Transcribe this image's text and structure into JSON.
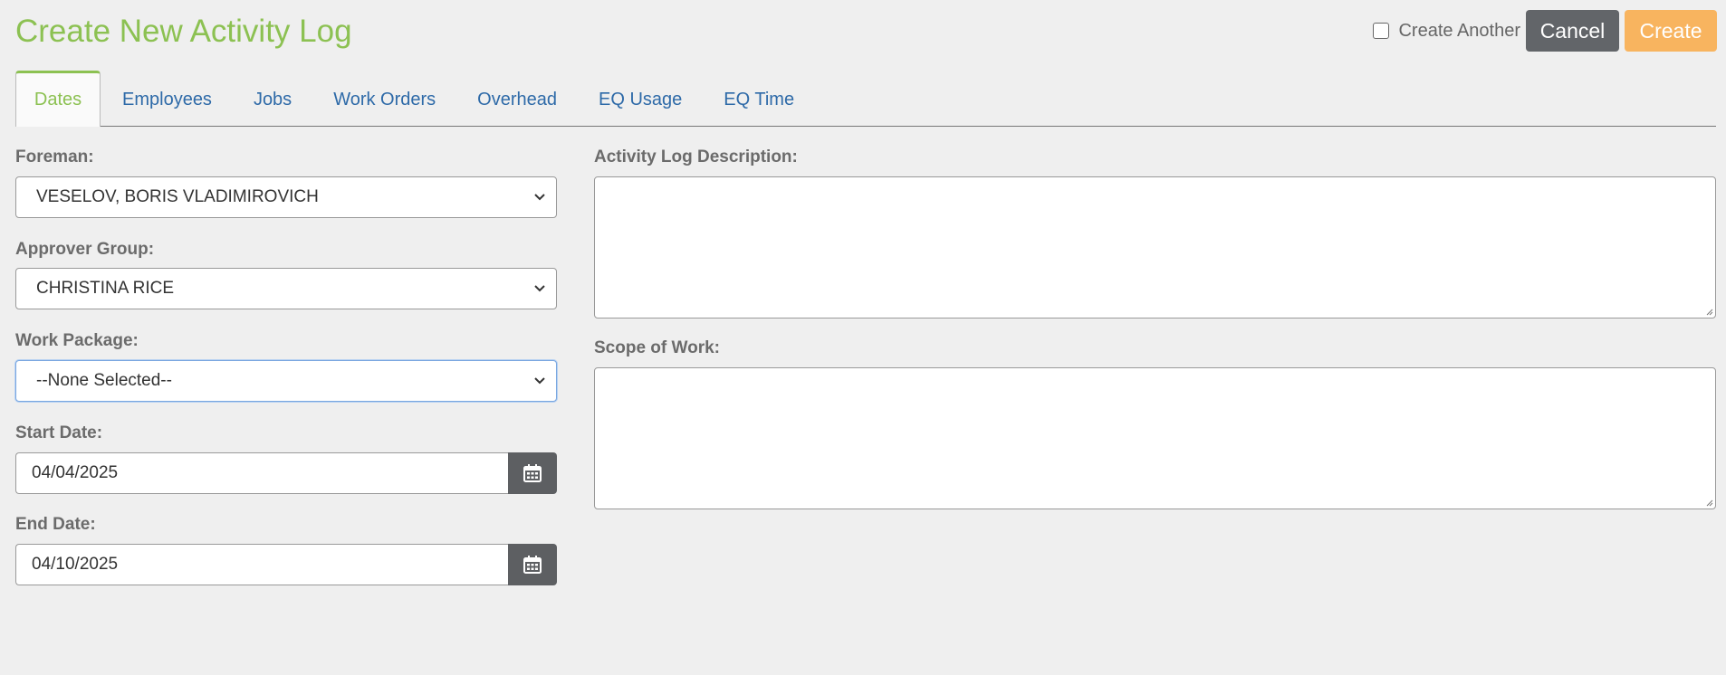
{
  "header": {
    "title": "Create New Activity Log",
    "create_another_label": "Create Another",
    "create_another_checked": false,
    "cancel_label": "Cancel",
    "create_label": "Create"
  },
  "tabs": [
    {
      "label": "Dates",
      "active": true
    },
    {
      "label": "Employees",
      "active": false
    },
    {
      "label": "Jobs",
      "active": false
    },
    {
      "label": "Work Orders",
      "active": false
    },
    {
      "label": "Overhead",
      "active": false
    },
    {
      "label": "EQ Usage",
      "active": false
    },
    {
      "label": "EQ Time",
      "active": false
    }
  ],
  "form": {
    "foreman": {
      "label": "Foreman:",
      "value": "VESELOV, BORIS VLADIMIROVICH"
    },
    "approver_group": {
      "label": "Approver Group:",
      "value": "CHRISTINA RICE"
    },
    "work_package": {
      "label": "Work Package:",
      "value": "--None Selected--"
    },
    "start_date": {
      "label": "Start Date:",
      "value": "04/04/2025"
    },
    "end_date": {
      "label": "End Date:",
      "value": "04/10/2025"
    },
    "description": {
      "label": "Activity Log Description:",
      "value": ""
    },
    "scope_of_work": {
      "label": "Scope of Work:",
      "value": ""
    }
  },
  "colors": {
    "title_green": "#8cc152",
    "link_blue": "#2e6aa8",
    "cancel_gray": "#626569",
    "create_orange": "#f8b45f"
  },
  "icons": {
    "calendar": "calendar-icon",
    "chevron": "chevron-down-icon"
  }
}
